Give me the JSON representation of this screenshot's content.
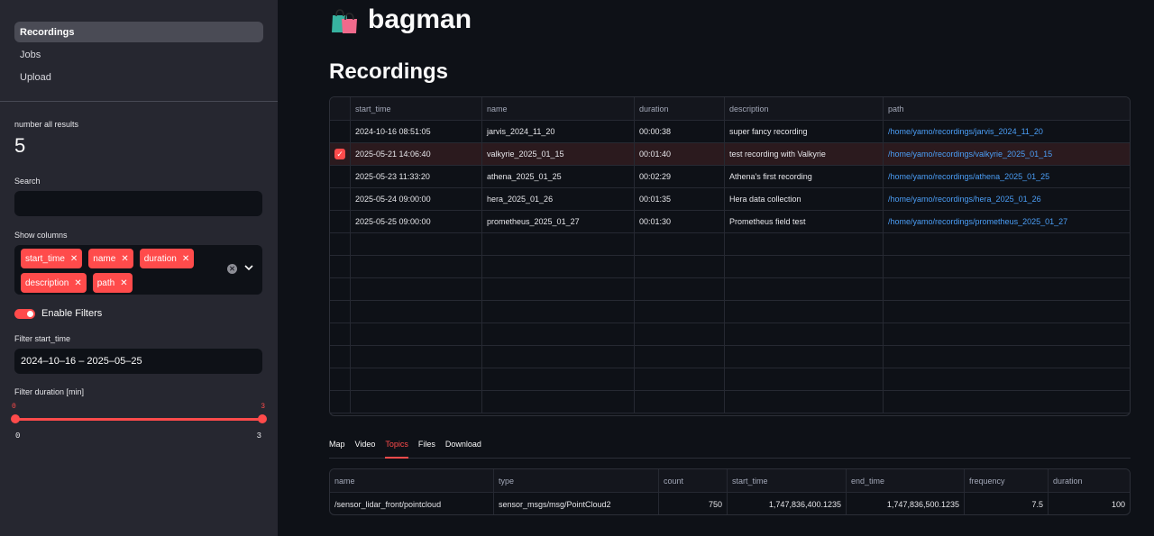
{
  "sidebar": {
    "nav": [
      "Recordings",
      "Jobs",
      "Upload"
    ],
    "metric_label": "number all results",
    "metric_value": "5",
    "search_label": "Search",
    "search_value": "",
    "columns_label": "Show columns",
    "columns_selected": [
      "start_time",
      "name",
      "duration",
      "description",
      "path"
    ],
    "filters_label": "Enable Filters",
    "filters_enabled": true,
    "filter_start_label": "Filter start_time",
    "filter_start_value": "2024–10–16 – 2025–05–25",
    "filter_duration_label": "Filter duration [min]",
    "slider": {
      "low": "0",
      "high": "3",
      "min_tick": "0",
      "max_tick": "3"
    }
  },
  "header": {
    "brand": "bagman",
    "logo_icon": "shopping-bags-icon",
    "page_title": "Recordings"
  },
  "recordings": {
    "columns": [
      "start_time",
      "name",
      "duration",
      "description",
      "path"
    ],
    "rows": [
      {
        "start_time": "2024-10-16 08:51:05",
        "name": "jarvis_2024_11_20",
        "duration": "00:00:38",
        "description": "super fancy recording",
        "path": "/home/yamo/recordings/jarvis_2024_11_20",
        "selected": false
      },
      {
        "start_time": "2025-05-21 14:06:40",
        "name": "valkyrie_2025_01_15",
        "duration": "00:01:40",
        "description": "test recording with Valkyrie",
        "path": "/home/yamo/recordings/valkyrie_2025_01_15",
        "selected": true
      },
      {
        "start_time": "2025-05-23 11:33:20",
        "name": "athena_2025_01_25",
        "duration": "00:02:29",
        "description": "Athena's first recording",
        "path": "/home/yamo/recordings/athena_2025_01_25",
        "selected": false
      },
      {
        "start_time": "2025-05-24 09:00:00",
        "name": "hera_2025_01_26",
        "duration": "00:01:35",
        "description": "Hera data collection",
        "path": "/home/yamo/recordings/hera_2025_01_26",
        "selected": false
      },
      {
        "start_time": "2025-05-25 09:00:00",
        "name": "prometheus_2025_01_27",
        "duration": "00:01:30",
        "description": "Prometheus field test",
        "path": "/home/yamo/recordings/prometheus_2025_01_27",
        "selected": false
      }
    ]
  },
  "tabs": {
    "items": [
      "Map",
      "Video",
      "Topics",
      "Files",
      "Download"
    ],
    "active": "Topics"
  },
  "topics": {
    "columns": [
      "name",
      "type",
      "count",
      "start_time",
      "end_time",
      "frequency",
      "duration"
    ],
    "rows": [
      {
        "name": "/sensor_lidar_front/pointcloud",
        "type": "sensor_msgs/msg/PointCloud2",
        "count": "750",
        "start_time": "1,747,836,400.1235",
        "end_time": "1,747,836,500.1235",
        "frequency": "7.5",
        "duration": "100"
      }
    ]
  },
  "colors": {
    "accent": "#ff4b4b",
    "link": "#4b9ef6",
    "sidebar_bg": "#262730",
    "main_bg": "#0e1117"
  }
}
